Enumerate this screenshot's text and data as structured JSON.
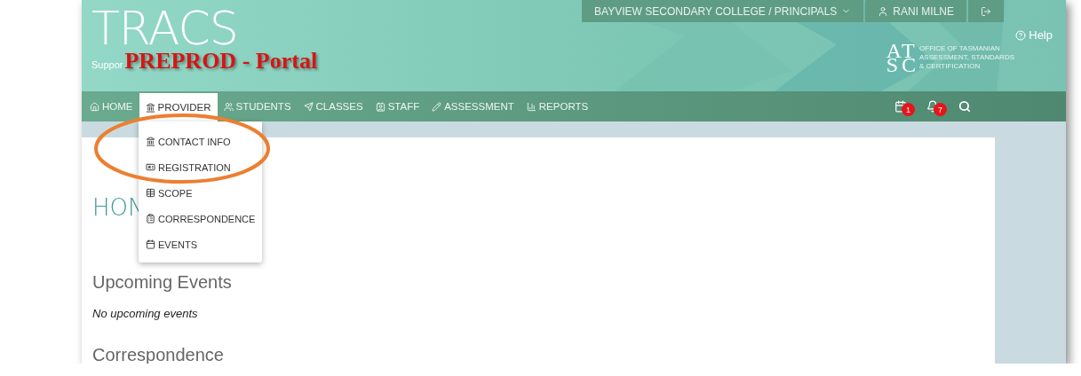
{
  "header": {
    "logo": "TRACS",
    "tagline": "Suppor",
    "environment_label": "PREPROD - Portal",
    "account_menu": [
      {
        "kind": "dropdown",
        "label": "BAYVIEW SECONDARY COLLEGE / PRINCIPALS"
      },
      {
        "kind": "user",
        "label": "RANI MILNE"
      },
      {
        "kind": "logout"
      }
    ],
    "help": "Help",
    "agency_logo": {
      "initials": "ATSC",
      "lines": [
        "OFFICE OF TASMANIAN",
        "ASSESSMENT, STANDARDS",
        "& CERTIFICATION"
      ]
    }
  },
  "nav": {
    "items": [
      {
        "label": "HOME",
        "selected": false
      },
      {
        "label": "PROVIDER",
        "selected": true
      },
      {
        "label": "STUDENTS",
        "selected": false
      },
      {
        "label": "CLASSES",
        "selected": false
      },
      {
        "label": "STAFF",
        "selected": false
      },
      {
        "label": "ASSESSMENT",
        "selected": false
      },
      {
        "label": "REPORTS",
        "selected": false
      }
    ],
    "actions": [
      {
        "kind": "calendar",
        "badge": "1"
      },
      {
        "kind": "notifications",
        "badge": "7"
      },
      {
        "kind": "search"
      }
    ]
  },
  "dropdown": {
    "items": [
      "CONTACT INFO",
      "REGISTRATION",
      "SCOPE",
      "CORRESPONDENCE",
      "EVENTS"
    ]
  },
  "page": {
    "heading": "HON",
    "sections": [
      {
        "title": "Upcoming Events",
        "body": "No upcoming events"
      },
      {
        "title": "Correspondence"
      }
    ]
  }
}
